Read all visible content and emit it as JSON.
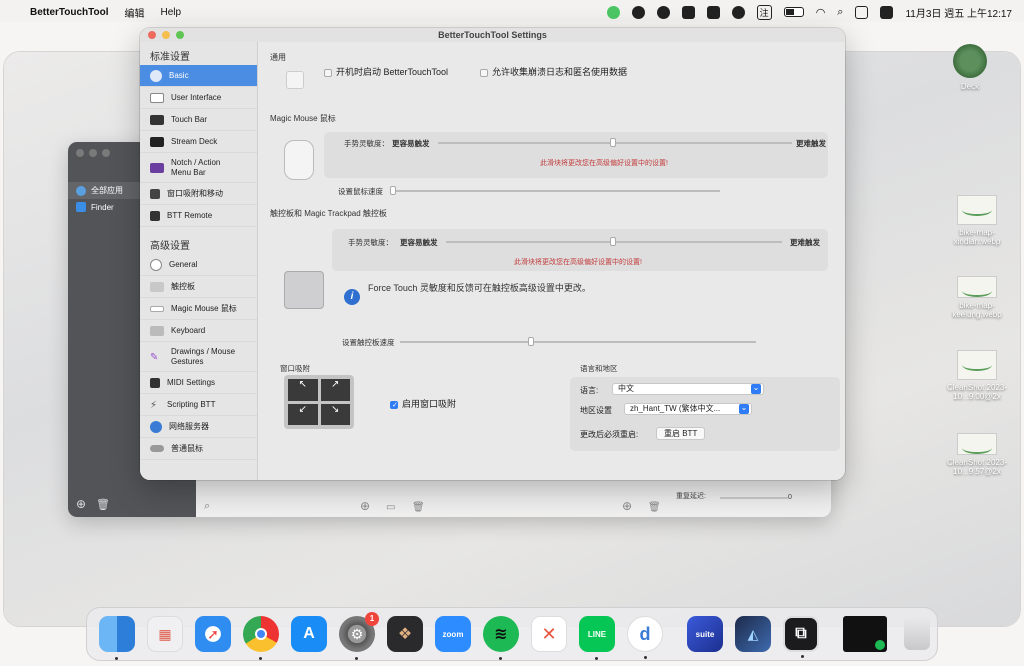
{
  "menubar": {
    "app_name": "BetterTouchTool",
    "menus": [
      "编辑",
      "Help"
    ],
    "datetime": "11月3日 週五 上午12:17",
    "input_method": "注"
  },
  "settings_window": {
    "title": "BetterTouchTool Settings",
    "sidebar": {
      "section1_title": "标准设置",
      "section1_items": [
        "Basic",
        "User Interface",
        "Touch Bar",
        "Stream Deck",
        "Notch / Action Menu Bar",
        "窗口吸附和移动",
        "BTT Remote"
      ],
      "section2_title": "高级设置",
      "section2_items": [
        "General",
        "触控板",
        "Magic Mouse 鼠标",
        "Keyboard",
        "Drawings / Mouse Gestures",
        "MIDI Settings",
        "Scripting BTT",
        "网络服务器",
        "普通鼠标"
      ]
    },
    "general": {
      "title": "通用",
      "launch_at_login": "开机时启动 BetterTouchTool",
      "allow_crash_logs": "允许收集崩溃日志和匿名使用数据"
    },
    "magic_mouse": {
      "title": "Magic Mouse 鼠标",
      "sensitivity_label": "手势灵敏度：",
      "easier_label": "更容易触发",
      "harder_label": "更难触发",
      "warning": "此滑块将更改您在高级偏好设置中的设置!",
      "speed_label": "设置鼠标速度"
    },
    "trackpad": {
      "title": "触控板和 Magic Trackpad 触控板",
      "sensitivity_label": "手势灵敏度：",
      "easier_label": "更容易触发",
      "harder_label": "更难触发",
      "warning": "此滑块将更改您在高级偏好设置中的设置!",
      "force_touch_info": "Force Touch 灵敏度和反馈可在触控板高级设置中更改。",
      "speed_label": "设置触控板速度"
    },
    "window_snapping": {
      "title": "窗口吸附",
      "enable_label": "启用窗口吸附"
    },
    "language_region": {
      "title": "语言和地区",
      "language_label": "语言:",
      "language_value": "中文",
      "region_label": "地区设置",
      "region_value": "zh_Hant_TW (繁体中文...",
      "restart_label": "更改后必须重启:",
      "restart_button": "重启 BTT"
    }
  },
  "back_window": {
    "sidebar_items": [
      "全部应用",
      "Finder"
    ],
    "repeat_delay_label": "重复延迟:",
    "repeat_delay_value": "0"
  },
  "desktop": {
    "icons": [
      {
        "label": "Deck"
      },
      {
        "label": "bike-map-xindian.webp"
      },
      {
        "label": "bike-map-keelung.webp"
      },
      {
        "label": "CleanShot 2023-10...9.00@2x"
      },
      {
        "label": "CleanShot 2023-10...9.57@2x"
      }
    ]
  },
  "dock": {
    "apps": [
      "Finder",
      "Launchpad",
      "Safari",
      "Chrome",
      "App Store",
      "System Settings",
      "Pasta",
      "Zoom",
      "Spotify",
      "XMind",
      "LINE",
      "Dictionary",
      "Suite",
      "Maps",
      "BTT",
      "Terminal",
      "Trash"
    ],
    "zoom_label": "zoom",
    "suite_label": "suite",
    "line_label": "LINE",
    "settings_badge": "1"
  },
  "colors": {
    "accent": "#4a8de3",
    "warning": "#c23b3b"
  }
}
